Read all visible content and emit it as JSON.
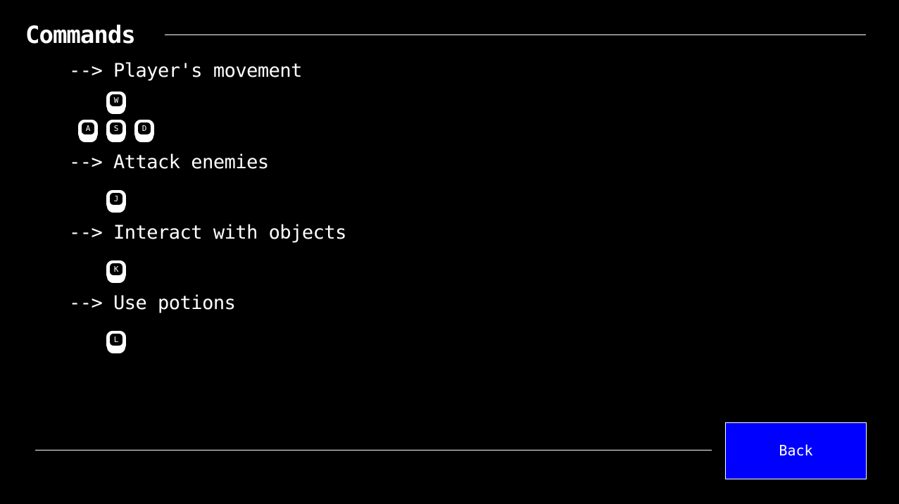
{
  "header": {
    "title": "Commands"
  },
  "sections": [
    {
      "label": "--> Player's movement",
      "keys": [
        "W",
        "A",
        "S",
        "D"
      ]
    },
    {
      "label": "--> Attack enemies",
      "keys": [
        "J"
      ]
    },
    {
      "label": "--> Interact with objects",
      "keys": [
        "K"
      ]
    },
    {
      "label": "--> Use potions",
      "keys": [
        "L"
      ]
    }
  ],
  "footer": {
    "back_label": "Back"
  },
  "colors": {
    "background": "#000000",
    "text": "#ffffff",
    "button": "#0000ff"
  },
  "icons": {
    "key": "keyboard-key-icon"
  }
}
